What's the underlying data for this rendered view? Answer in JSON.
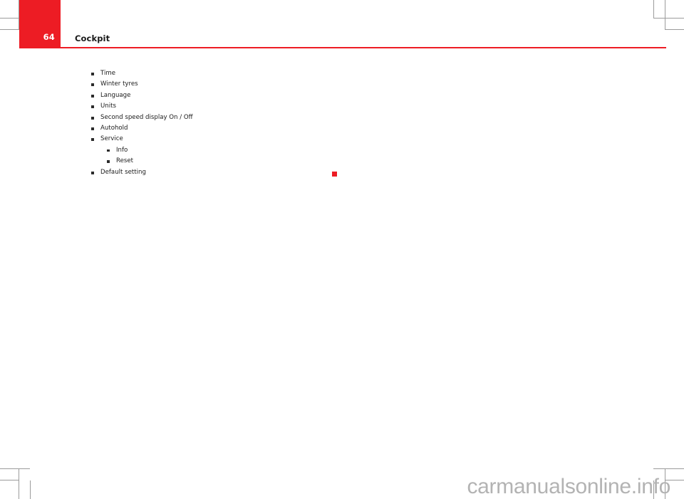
{
  "header": {
    "page_number": "64",
    "title": "Cockpit",
    "band_color": "#ed1c24",
    "rule_color": "#ed1c24"
  },
  "content": {
    "list_items": [
      {
        "label": "Time",
        "level": 1
      },
      {
        "label": "Winter tyres",
        "level": 1
      },
      {
        "label": "Language",
        "level": 1
      },
      {
        "label": "Units",
        "level": 1
      },
      {
        "label": "Second speed display On / Off",
        "level": 1
      },
      {
        "label": "Autohold",
        "level": 1
      },
      {
        "label": "Service",
        "level": 1
      },
      {
        "label": "Info",
        "level": 2
      },
      {
        "label": "Reset",
        "level": 2
      },
      {
        "label": "Default setting",
        "level": 1
      }
    ],
    "continuation_marker": {
      "name": "continuation-square",
      "color": "#ed1c24"
    }
  },
  "watermark": {
    "text": "carmanualsonline.info",
    "color": "#b3b3b3"
  },
  "crop_marks": {
    "color": "#9b9b9b"
  }
}
